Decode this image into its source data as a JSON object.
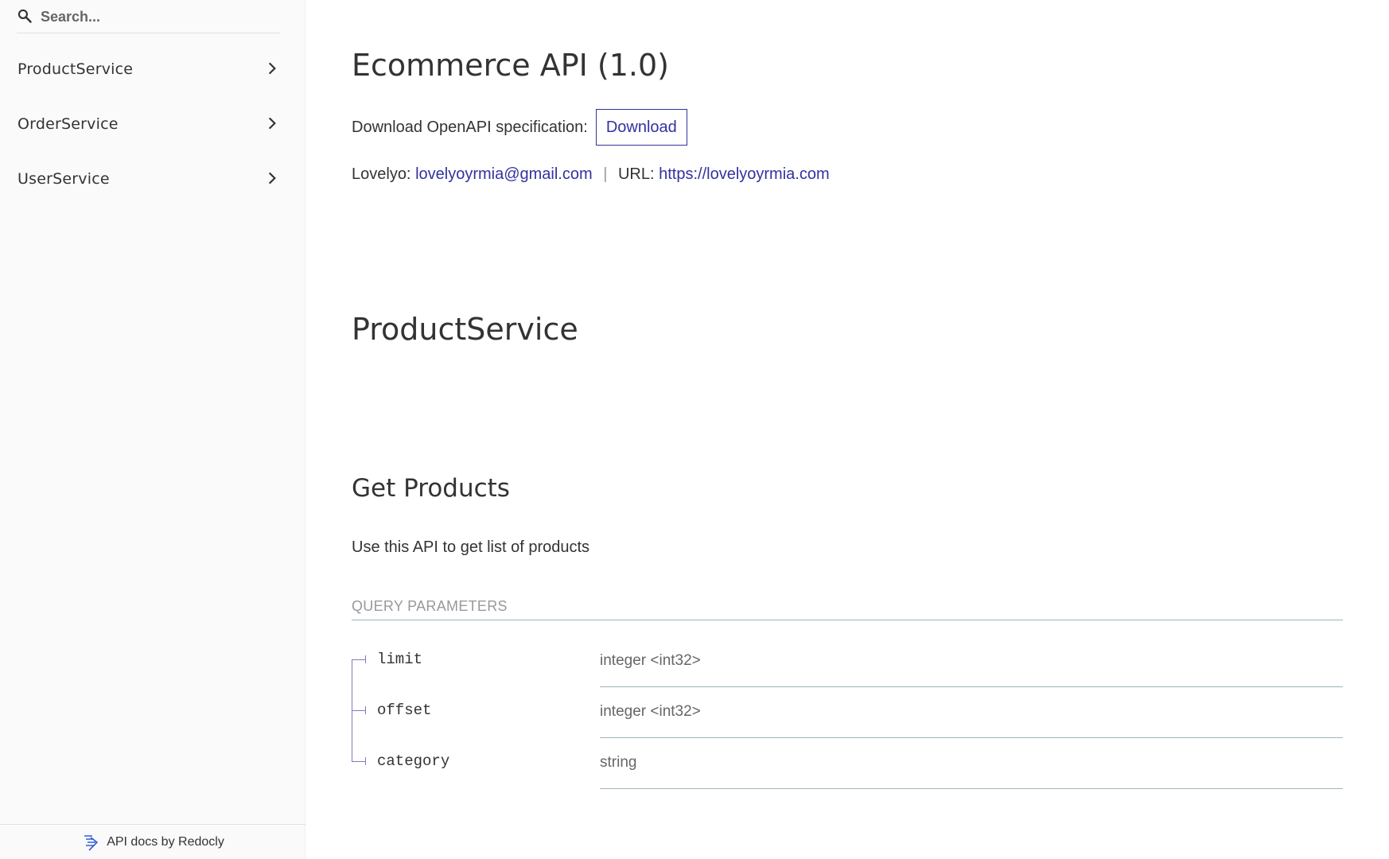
{
  "sidebar": {
    "search": {
      "placeholder": "Search...",
      "value": ""
    },
    "items": [
      {
        "label": "ProductService"
      },
      {
        "label": "OrderService"
      },
      {
        "label": "UserService"
      }
    ],
    "footer": {
      "text": "API docs by Redocly"
    }
  },
  "main": {
    "title": "Ecommerce API (1.0)",
    "download": {
      "label": "Download OpenAPI specification:",
      "button": "Download"
    },
    "contact": {
      "name_label": "Lovelyo:",
      "email": "lovelyoyrmia@gmail.com",
      "separator": "|",
      "url_label": "URL:",
      "url": "https://lovelyoyrmia.com"
    },
    "section_title": "ProductService",
    "operation": {
      "title": "Get Products",
      "description": "Use this API to get list of products",
      "query_header": "Query Parameters",
      "params": [
        {
          "name": "limit",
          "type": "integer <int32>"
        },
        {
          "name": "offset",
          "type": "integer <int32>"
        },
        {
          "name": "category",
          "type": "string"
        }
      ]
    }
  },
  "colors": {
    "link": "#32329f",
    "sidebar_bg": "#fafafa",
    "divider": "#9fb4be"
  }
}
